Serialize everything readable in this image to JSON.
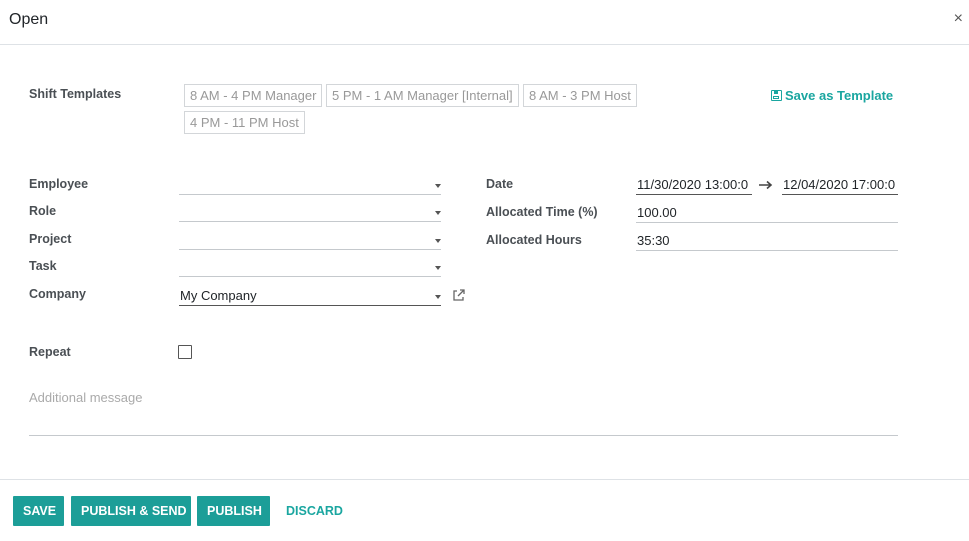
{
  "dialog": {
    "title": "Open",
    "close_symbol": "×"
  },
  "shift_templates": {
    "label": "Shift Templates",
    "items": [
      "8 AM - 4 PM Manager",
      "5 PM - 1 AM Manager [Internal]",
      "8 AM - 3 PM Host",
      "4 PM - 11 PM Host"
    ],
    "save_as_template": "Save as Template"
  },
  "form": {
    "employee": {
      "label": "Employee",
      "value": ""
    },
    "role": {
      "label": "Role",
      "value": ""
    },
    "project": {
      "label": "Project",
      "value": ""
    },
    "task": {
      "label": "Task",
      "value": ""
    },
    "company": {
      "label": "Company",
      "value": "My Company"
    },
    "date": {
      "label": "Date",
      "start": "11/30/2020 13:00:0",
      "end": "12/04/2020 17:00:0"
    },
    "allocated_time": {
      "label": "Allocated Time (%)",
      "value": "100.00"
    },
    "allocated_hours": {
      "label": "Allocated Hours",
      "value": "35:30"
    },
    "repeat": {
      "label": "Repeat",
      "checked": false
    },
    "additional_message": {
      "placeholder": "Additional message"
    }
  },
  "footer": {
    "save": "SAVE",
    "publish_send": "PUBLISH & SEND",
    "publish": "PUBLISH",
    "discard": "DISCARD"
  },
  "colors": {
    "accent": "#1c9e98",
    "link": "#1aa6a0"
  }
}
